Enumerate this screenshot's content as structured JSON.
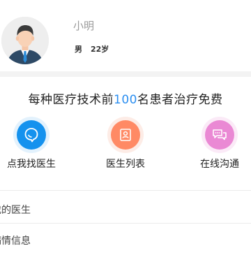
{
  "profile": {
    "name": "小明",
    "gender": "男",
    "age": "22岁"
  },
  "promo": {
    "prefix": "每种医疗技术前",
    "number": "100",
    "suffix": "名患者治疗免费"
  },
  "features": [
    {
      "label": "点我找医生",
      "icon": "search-bubble-icon",
      "color": "#1592ee"
    },
    {
      "label": "医生列表",
      "icon": "doctor-card-icon",
      "color": "#ff8a65"
    },
    {
      "label": "在线沟通",
      "icon": "chat-bubbles-icon",
      "color": "#ea89d4"
    }
  ],
  "list": [
    {
      "label": "我的医生"
    },
    {
      "label": "病情信息"
    }
  ]
}
